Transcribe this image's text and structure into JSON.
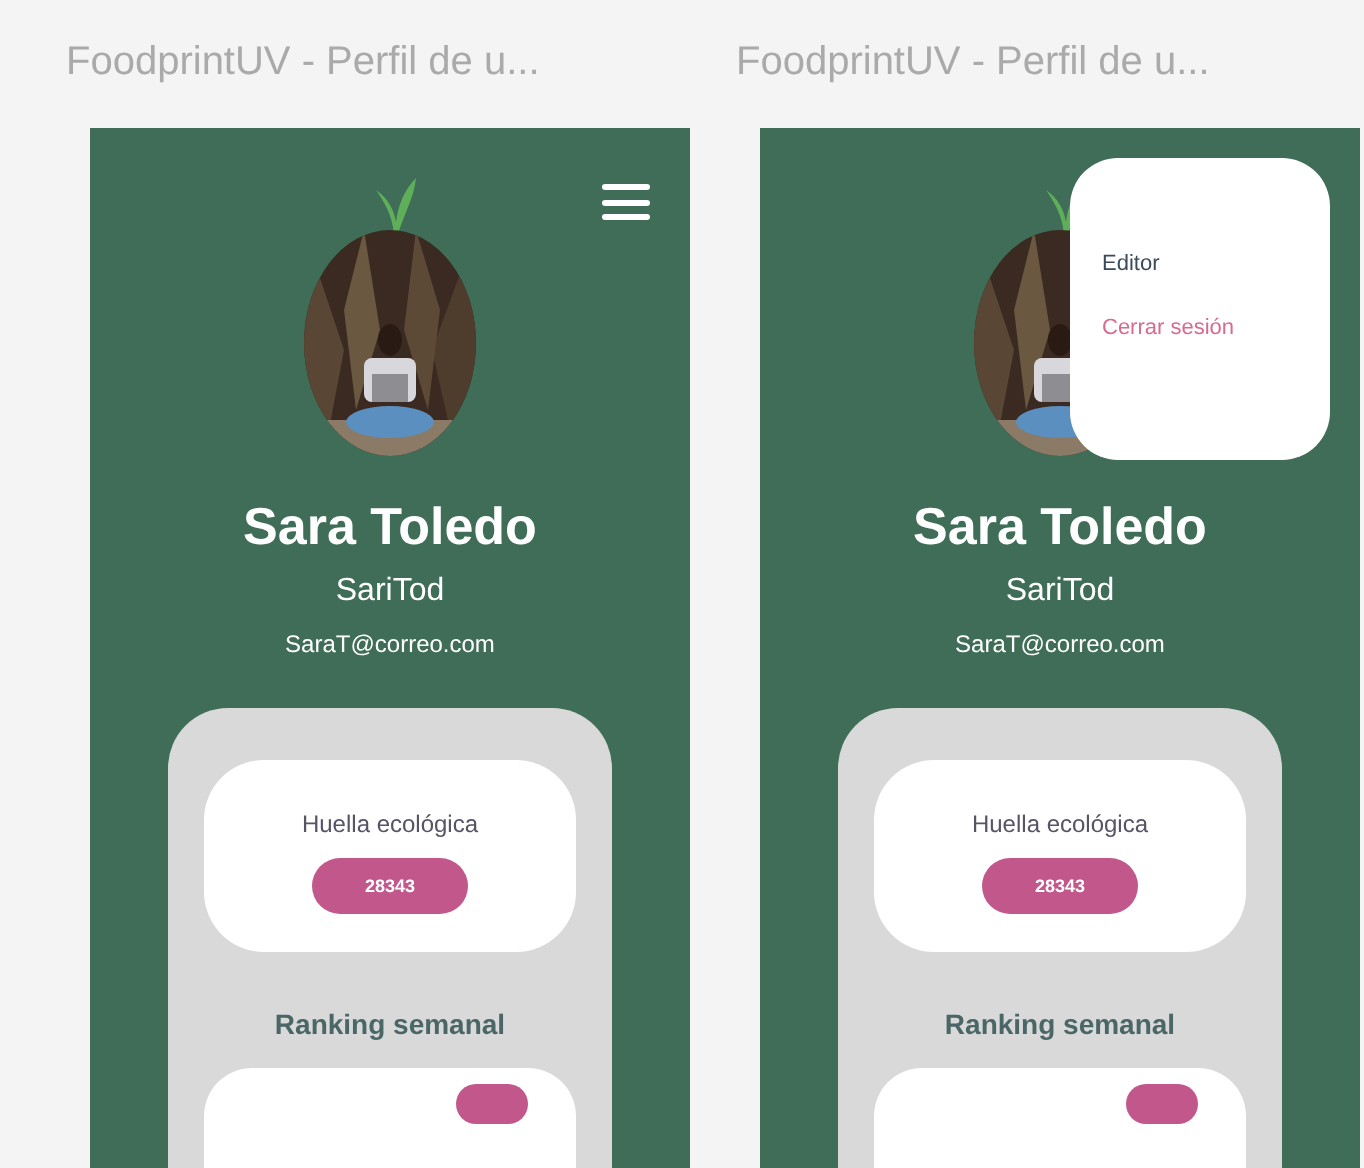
{
  "screens": [
    {
      "title": "FoodprintUV - Perfil de u...",
      "menu_open": false,
      "name": "Sara Toledo",
      "username": "SariTod",
      "email": "SaraT@correo.com",
      "footprint": {
        "label": "Huella ecológica",
        "value": "28343"
      },
      "ranking": {
        "title": "Ranking semanal"
      }
    },
    {
      "title": "FoodprintUV - Perfil de u...",
      "menu_open": true,
      "menu_items": [
        {
          "label": "Editor",
          "kind": "normal"
        },
        {
          "label": "Cerrar sesión",
          "kind": "danger"
        }
      ],
      "name": "Sara Toledo",
      "username": "SariTod",
      "email": "SaraT@correo.com",
      "footprint": {
        "label": "Huella ecológica",
        "value": "28343"
      },
      "ranking": {
        "title": "Ranking semanal"
      }
    }
  ]
}
